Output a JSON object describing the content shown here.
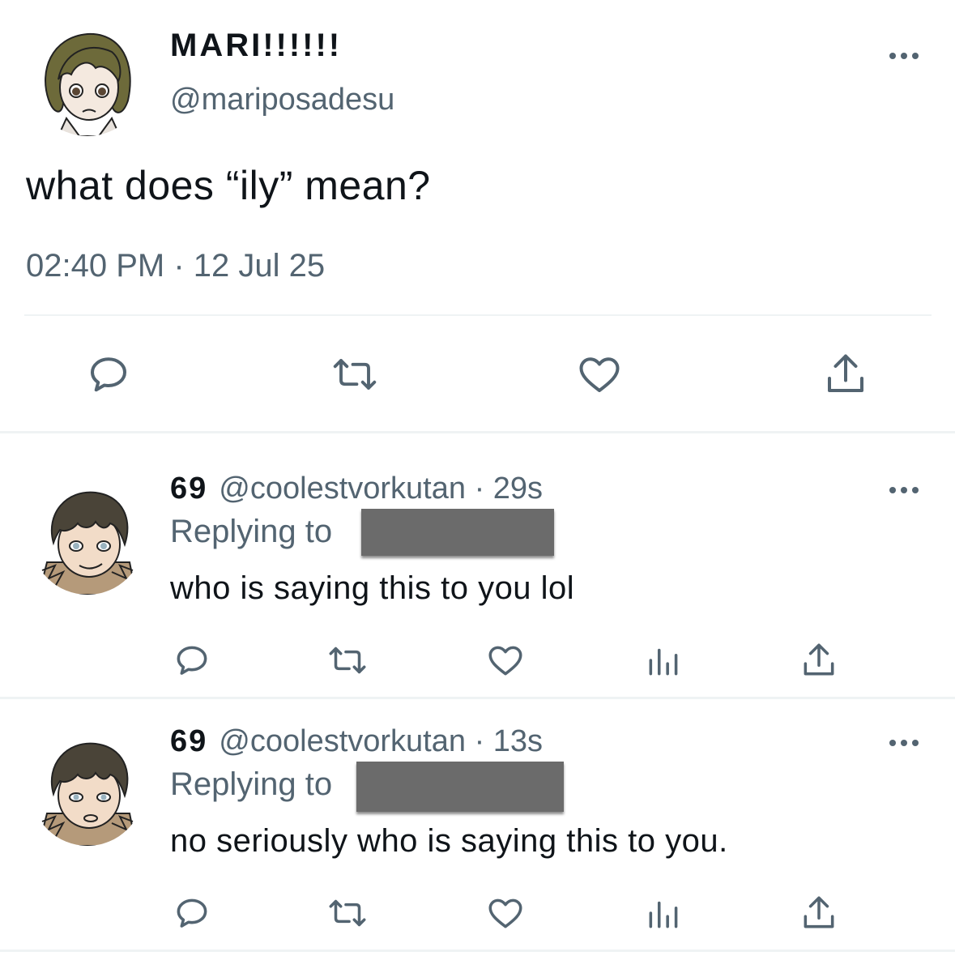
{
  "main_tweet": {
    "display_name": "MARI!!!!!!",
    "handle": "@mariposadesu",
    "text": "what does “ily” mean?",
    "timestamp": "02:40 PM · 12 Jul 25",
    "actions": [
      "reply-icon",
      "retweet-icon",
      "like-icon",
      "share-icon"
    ]
  },
  "replies": [
    {
      "display_name": "69",
      "handle": "@coolestvorkutan",
      "time": "· 29s",
      "replying_label": "Replying to",
      "text": "who is saying this to you lol",
      "actions": [
        "reply-icon",
        "retweet-icon",
        "like-icon",
        "analytics-icon",
        "share-icon"
      ]
    },
    {
      "display_name": "69",
      "handle": "@coolestvorkutan",
      "time": "· 13s",
      "replying_label": "Replying to",
      "text": "no seriously who is saying this to you.",
      "actions": [
        "reply-icon",
        "retweet-icon",
        "like-icon",
        "analytics-icon",
        "share-icon"
      ]
    }
  ],
  "colors": {
    "text": "#0f1419",
    "secondary": "#536471",
    "divider": "#eff3f4",
    "redaction": "#6b6b6b"
  }
}
